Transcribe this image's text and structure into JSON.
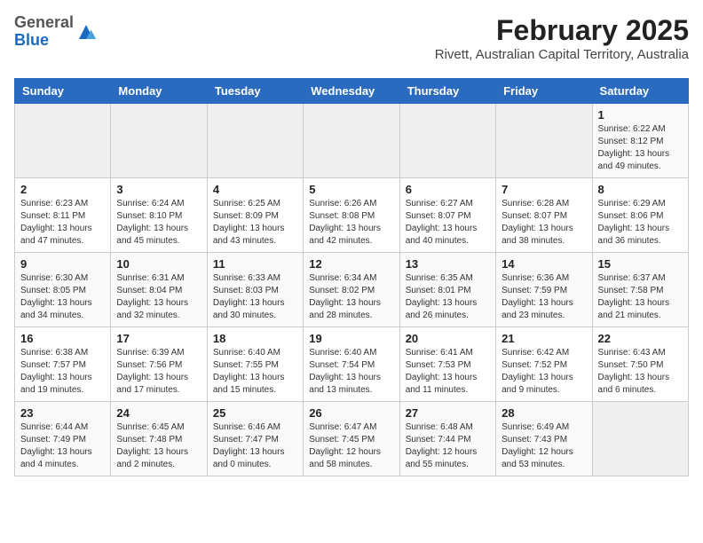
{
  "header": {
    "logo_general": "General",
    "logo_blue": "Blue",
    "title": "February 2025",
    "subtitle": "Rivett, Australian Capital Territory, Australia"
  },
  "weekdays": [
    "Sunday",
    "Monday",
    "Tuesday",
    "Wednesday",
    "Thursday",
    "Friday",
    "Saturday"
  ],
  "weeks": [
    [
      {
        "day": "",
        "info": ""
      },
      {
        "day": "",
        "info": ""
      },
      {
        "day": "",
        "info": ""
      },
      {
        "day": "",
        "info": ""
      },
      {
        "day": "",
        "info": ""
      },
      {
        "day": "",
        "info": ""
      },
      {
        "day": "1",
        "info": "Sunrise: 6:22 AM\nSunset: 8:12 PM\nDaylight: 13 hours\nand 49 minutes."
      }
    ],
    [
      {
        "day": "2",
        "info": "Sunrise: 6:23 AM\nSunset: 8:11 PM\nDaylight: 13 hours\nand 47 minutes."
      },
      {
        "day": "3",
        "info": "Sunrise: 6:24 AM\nSunset: 8:10 PM\nDaylight: 13 hours\nand 45 minutes."
      },
      {
        "day": "4",
        "info": "Sunrise: 6:25 AM\nSunset: 8:09 PM\nDaylight: 13 hours\nand 43 minutes."
      },
      {
        "day": "5",
        "info": "Sunrise: 6:26 AM\nSunset: 8:08 PM\nDaylight: 13 hours\nand 42 minutes."
      },
      {
        "day": "6",
        "info": "Sunrise: 6:27 AM\nSunset: 8:07 PM\nDaylight: 13 hours\nand 40 minutes."
      },
      {
        "day": "7",
        "info": "Sunrise: 6:28 AM\nSunset: 8:07 PM\nDaylight: 13 hours\nand 38 minutes."
      },
      {
        "day": "8",
        "info": "Sunrise: 6:29 AM\nSunset: 8:06 PM\nDaylight: 13 hours\nand 36 minutes."
      }
    ],
    [
      {
        "day": "9",
        "info": "Sunrise: 6:30 AM\nSunset: 8:05 PM\nDaylight: 13 hours\nand 34 minutes."
      },
      {
        "day": "10",
        "info": "Sunrise: 6:31 AM\nSunset: 8:04 PM\nDaylight: 13 hours\nand 32 minutes."
      },
      {
        "day": "11",
        "info": "Sunrise: 6:33 AM\nSunset: 8:03 PM\nDaylight: 13 hours\nand 30 minutes."
      },
      {
        "day": "12",
        "info": "Sunrise: 6:34 AM\nSunset: 8:02 PM\nDaylight: 13 hours\nand 28 minutes."
      },
      {
        "day": "13",
        "info": "Sunrise: 6:35 AM\nSunset: 8:01 PM\nDaylight: 13 hours\nand 26 minutes."
      },
      {
        "day": "14",
        "info": "Sunrise: 6:36 AM\nSunset: 7:59 PM\nDaylight: 13 hours\nand 23 minutes."
      },
      {
        "day": "15",
        "info": "Sunrise: 6:37 AM\nSunset: 7:58 PM\nDaylight: 13 hours\nand 21 minutes."
      }
    ],
    [
      {
        "day": "16",
        "info": "Sunrise: 6:38 AM\nSunset: 7:57 PM\nDaylight: 13 hours\nand 19 minutes."
      },
      {
        "day": "17",
        "info": "Sunrise: 6:39 AM\nSunset: 7:56 PM\nDaylight: 13 hours\nand 17 minutes."
      },
      {
        "day": "18",
        "info": "Sunrise: 6:40 AM\nSunset: 7:55 PM\nDaylight: 13 hours\nand 15 minutes."
      },
      {
        "day": "19",
        "info": "Sunrise: 6:40 AM\nSunset: 7:54 PM\nDaylight: 13 hours\nand 13 minutes."
      },
      {
        "day": "20",
        "info": "Sunrise: 6:41 AM\nSunset: 7:53 PM\nDaylight: 13 hours\nand 11 minutes."
      },
      {
        "day": "21",
        "info": "Sunrise: 6:42 AM\nSunset: 7:52 PM\nDaylight: 13 hours\nand 9 minutes."
      },
      {
        "day": "22",
        "info": "Sunrise: 6:43 AM\nSunset: 7:50 PM\nDaylight: 13 hours\nand 6 minutes."
      }
    ],
    [
      {
        "day": "23",
        "info": "Sunrise: 6:44 AM\nSunset: 7:49 PM\nDaylight: 13 hours\nand 4 minutes."
      },
      {
        "day": "24",
        "info": "Sunrise: 6:45 AM\nSunset: 7:48 PM\nDaylight: 13 hours\nand 2 minutes."
      },
      {
        "day": "25",
        "info": "Sunrise: 6:46 AM\nSunset: 7:47 PM\nDaylight: 13 hours\nand 0 minutes."
      },
      {
        "day": "26",
        "info": "Sunrise: 6:47 AM\nSunset: 7:45 PM\nDaylight: 12 hours\nand 58 minutes."
      },
      {
        "day": "27",
        "info": "Sunrise: 6:48 AM\nSunset: 7:44 PM\nDaylight: 12 hours\nand 55 minutes."
      },
      {
        "day": "28",
        "info": "Sunrise: 6:49 AM\nSunset: 7:43 PM\nDaylight: 12 hours\nand 53 minutes."
      },
      {
        "day": "",
        "info": ""
      }
    ]
  ]
}
